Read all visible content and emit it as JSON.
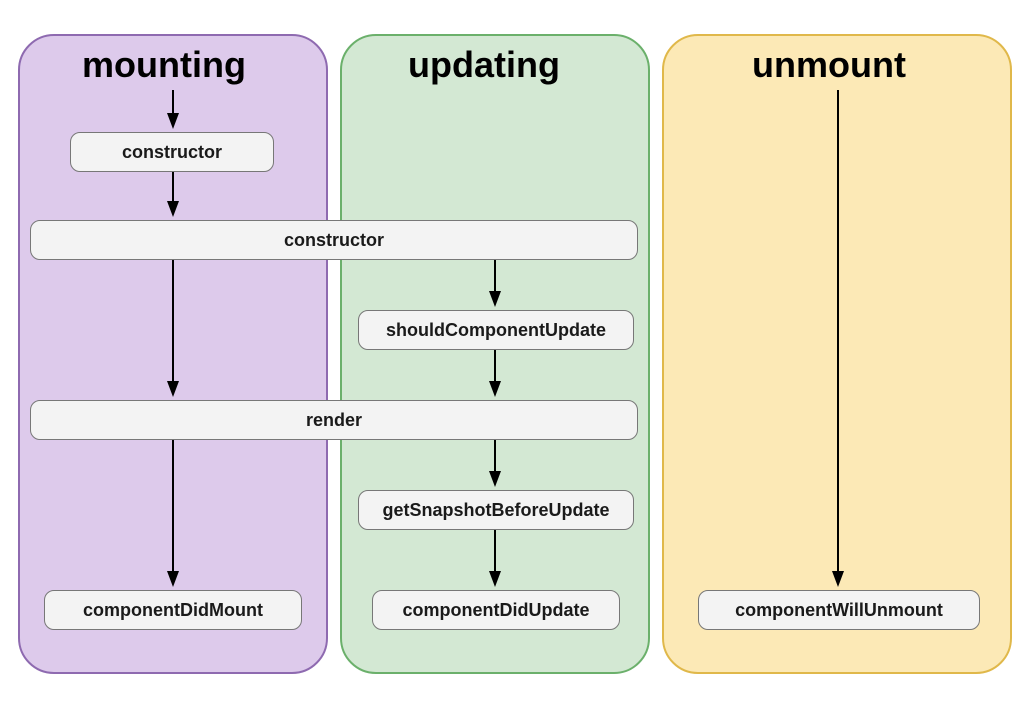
{
  "columns": {
    "mounting": {
      "title": "mounting"
    },
    "updating": {
      "title": "updating"
    },
    "unmount": {
      "title": "unmount"
    }
  },
  "methods": {
    "constructor1": "constructor",
    "constructor2": "constructor",
    "shouldComponentUpdate": "shouldComponentUpdate",
    "render": "render",
    "getSnapshotBeforeUpdate": "getSnapshotBeforeUpdate",
    "componentDidMount": "componentDidMount",
    "componentDidUpdate": "componentDidUpdate",
    "componentWillUnmount": "componentWillUnmount"
  },
  "flows": {
    "mounting": [
      "constructor",
      "constructor",
      "render",
      "componentDidMount"
    ],
    "updating": [
      "constructor",
      "shouldComponentUpdate",
      "render",
      "getSnapshotBeforeUpdate",
      "componentDidUpdate"
    ],
    "unmount": [
      "componentWillUnmount"
    ]
  }
}
